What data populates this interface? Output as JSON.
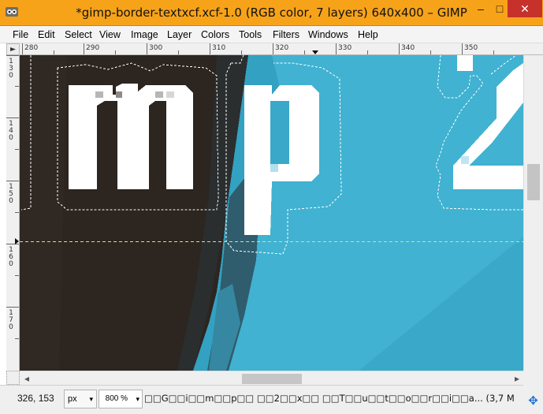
{
  "window": {
    "title": "*gimp-border-textxcf.xcf-1.0 (RGB color, 7 layers) 640x400 – GIMP",
    "minimize": "–",
    "maximize": "□",
    "close": "✕"
  },
  "menu": [
    "File",
    "Edit",
    "Select",
    "View",
    "Image",
    "Layer",
    "Colors",
    "Tools",
    "Filters",
    "Windows",
    "Help"
  ],
  "rulers": {
    "horizontal": [
      "280",
      "290",
      "300",
      "310",
      "320",
      "330",
      "340",
      "350"
    ],
    "vertical": [
      "130",
      "140",
      "150",
      "160",
      "170"
    ]
  },
  "canvas": {
    "text": "mp z",
    "colors": {
      "background": "#3aa9c9",
      "dark_brown": "#2c2520",
      "text": "#ffffff",
      "guide": "#e6e640"
    }
  },
  "statusbar": {
    "coords": "326, 153",
    "unit": "px",
    "zoom": "800 %",
    "message": "□□G□□i□□m□□p□□ □□2□□x□□ □□T□□u□□t□□o□□r□□i□□a... (3,7 MB)"
  },
  "icons": {
    "app": "gimp-icon",
    "unit_dropdown": "▾",
    "zoom_dropdown": "▾",
    "scroll_left": "◂",
    "scroll_right": "▸",
    "navigate": "✥"
  }
}
